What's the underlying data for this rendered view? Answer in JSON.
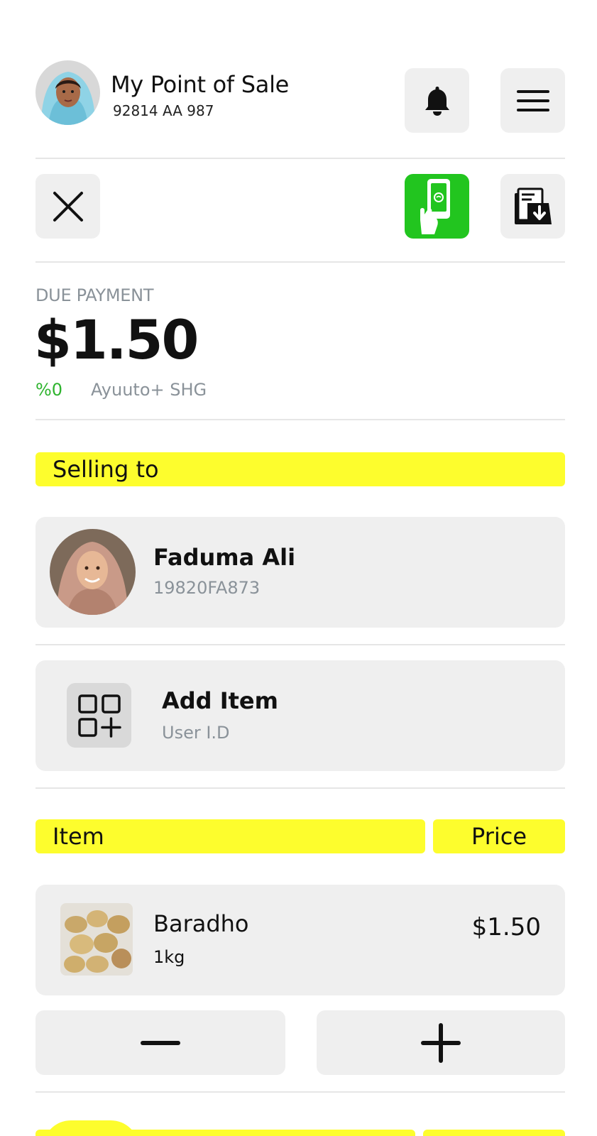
{
  "header": {
    "title": "My Point of Sale",
    "subtitle": "92814 AA 987",
    "icons": {
      "notification": "bell-icon",
      "menu": "hamburger-menu-icon"
    }
  },
  "toolbar": {
    "icons": {
      "close": "close-icon",
      "pay": "mobile-payment-icon",
      "receipt": "document-download-icon"
    },
    "accent_color": "#22c51f"
  },
  "due": {
    "label": "DUE PAYMENT",
    "amount": "$1.50",
    "percent": "%0",
    "group": "Ayuuto+ SHG"
  },
  "selling_to": {
    "label": "Selling to",
    "customer_name": "Faduma Ali",
    "customer_id": "19820FA873"
  },
  "add_item": {
    "title": "Add Item",
    "subtitle": "User I.D",
    "icon": "grid-add-icon"
  },
  "items_table": {
    "headers": {
      "item": "Item",
      "price": "Price"
    },
    "rows": [
      {
        "name": "Baradho",
        "unit": "1kg",
        "price": "$1.50"
      }
    ]
  },
  "quantity": {
    "decrease_icon": "minus-icon",
    "increase_icon": "plus-icon"
  },
  "colors": {
    "highlight": "#fdfd2d",
    "tile": "#efefef",
    "muted_text": "#8a9299",
    "positive": "#2fb42f"
  }
}
